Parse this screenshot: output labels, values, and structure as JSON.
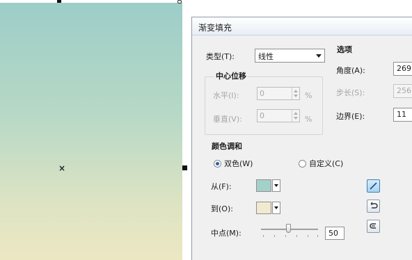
{
  "canvas": {
    "gradient_colors": {
      "top": "#9dcdc8",
      "bottom": "#ece7c3"
    },
    "center_marker": "×"
  },
  "dialog": {
    "title": "渐变填充",
    "type": {
      "label": "类型(T):",
      "value": "线性"
    },
    "center_offset": {
      "heading": "中心位移",
      "horizontal": {
        "label": "水平(I):",
        "value": "0",
        "unit": "%"
      },
      "vertical": {
        "label": "垂直(V):",
        "value": "0",
        "unit": "%"
      }
    },
    "options": {
      "heading": "选项",
      "angle": {
        "label": "角度(A):",
        "value": "269"
      },
      "steps": {
        "label": "步长(S):",
        "value": "256"
      },
      "edge_pad": {
        "label": "边界(E):",
        "value": "11"
      }
    },
    "color_blend": {
      "heading": "颜色调和",
      "two_color": {
        "label": "双色(W)",
        "selected": true
      },
      "custom": {
        "label": "自定义(C)",
        "selected": false
      },
      "from": {
        "label": "从(F):",
        "color": "#a4d0ca"
      },
      "to": {
        "label": "到(O):",
        "color": "#f1ead0"
      },
      "midpoint": {
        "label": "中点(M):",
        "value": "50"
      }
    },
    "blend_buttons": [
      "direct-blend-icon",
      "counterclockwise-blend-icon",
      "clockwise-blend-icon"
    ]
  }
}
